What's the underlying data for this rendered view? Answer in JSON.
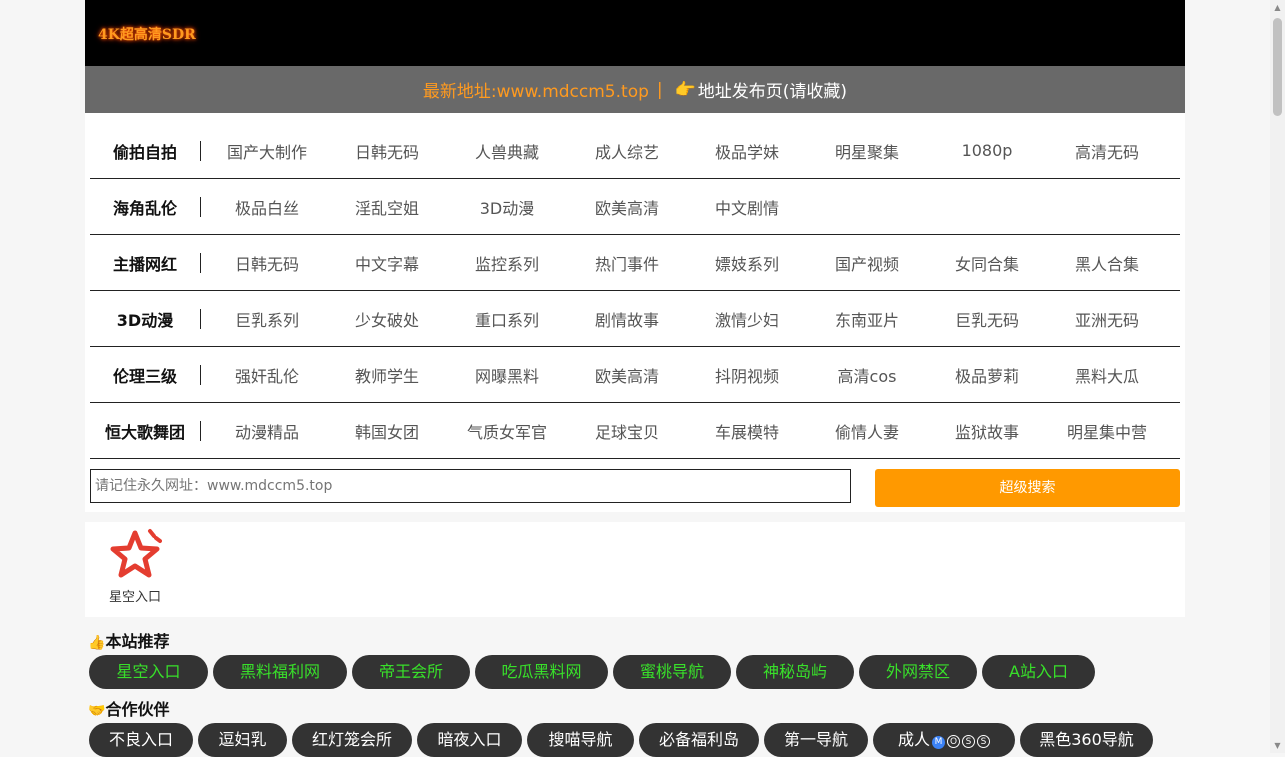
{
  "site": {
    "logo_text": "4K超高清SDR",
    "address_new": "最新地址:www.mdccm5.top",
    "address_sep": "|",
    "address_pub_icon": "pointing-hand-icon",
    "address_pub": "地址发布页(请收藏)"
  },
  "menu": [
    {
      "cat": "偷拍自拍",
      "items": [
        "国产大制作",
        "日韩无码",
        "人兽典藏",
        "成人综艺",
        "极品学妹",
        "明星聚集",
        "1080p",
        "高清无码"
      ]
    },
    {
      "cat": "海角乱伦",
      "items": [
        "极品白丝",
        "淫乱空姐",
        "3D动漫",
        "欧美高清",
        "中文剧情"
      ]
    },
    {
      "cat": "主播网红",
      "items": [
        "日韩无码",
        "中文字幕",
        "监控系列",
        "热门事件",
        "嫖妓系列",
        "国产视频",
        "女同合集",
        "黑人合集"
      ]
    },
    {
      "cat": "3D动漫",
      "items": [
        "巨乳系列",
        "少女破处",
        "重口系列",
        "剧情故事",
        "激情少妇",
        "东南亚片",
        "巨乳无码",
        "亚洲无码"
      ]
    },
    {
      "cat": "伦理三级",
      "items": [
        "强奸乱伦",
        "教师学生",
        "网曝黑料",
        "欧美高清",
        "抖阴视频",
        "高清cos",
        "极品萝莉",
        "黑料大瓜"
      ]
    },
    {
      "cat": "恒大歌舞团",
      "items": [
        "动漫精品",
        "韩国女团",
        "气质女军官",
        "足球宝贝",
        "车展模特",
        "偷情人妻",
        "监狱故事",
        "明星集中营"
      ]
    }
  ],
  "search": {
    "placeholder": "请记住永久网址：www.mdccm5.top",
    "button": "超级搜索"
  },
  "featured_tile": {
    "label": "星空入口",
    "icon": "red-star-icon"
  },
  "recommend": {
    "title": "本站推荐",
    "icon": "thumbs-up-icon",
    "items": [
      "星空入口",
      "黑料福利网",
      "帝王会所",
      "吃瓜黑料网",
      "蜜桃导航",
      "神秘岛屿",
      "外网禁区",
      "A站入口"
    ]
  },
  "partners": {
    "title": "合作伙伴",
    "icon": "handshake-icon",
    "items": [
      "不良入口",
      "逗妇乳",
      "红灯笼会所",
      "暗夜入口",
      "搜喵导航",
      "必备福利岛",
      "第一导航",
      "成人",
      "黑色360导航"
    ],
    "badge_letters": [
      "M",
      "O",
      "S",
      "S"
    ]
  },
  "colors": {
    "accent": "#ff9900",
    "green_text": "#38e02a",
    "pill_bg": "#333333",
    "bar_bg": "#696969"
  }
}
